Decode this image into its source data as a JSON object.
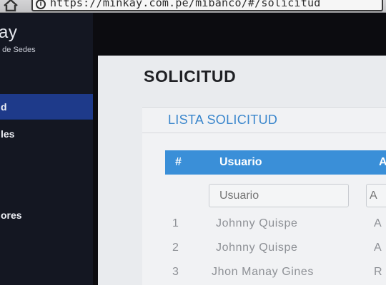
{
  "browser": {
    "url": "https://minkay.com.pe/mibanco/#/solicitud",
    "info_glyph": "i"
  },
  "sidebar": {
    "brand_title": "ay",
    "brand_subtitle": "n de Sedes",
    "items": [
      {
        "label": "d",
        "active": true
      },
      {
        "label": "les",
        "active": false
      },
      {
        "label": "",
        "active": false
      },
      {
        "label": "",
        "active": false
      },
      {
        "label": "ores",
        "active": false
      },
      {
        "label": "",
        "active": false
      },
      {
        "label": "",
        "active": false
      }
    ]
  },
  "page": {
    "title": "SOLICITUD",
    "card_title": "LISTA SOLICITUD",
    "table": {
      "columns": [
        "#",
        "Usuario",
        "A"
      ],
      "filters": {
        "usuario_placeholder": "Usuario",
        "next_placeholder": "A"
      },
      "rows": [
        {
          "num": "1",
          "usuario": "Johnny Quispe",
          "next": "A"
        },
        {
          "num": "2",
          "usuario": "Johnny Quispe",
          "next": "A"
        },
        {
          "num": "3",
          "usuario": "Jhon Manay Gines",
          "next": "R"
        }
      ]
    }
  },
  "colors": {
    "sidebar_bg": "#141722",
    "sidebar_active": "#1e3a8a",
    "accent": "#3a8fd8",
    "card_title": "#3a86cc"
  }
}
